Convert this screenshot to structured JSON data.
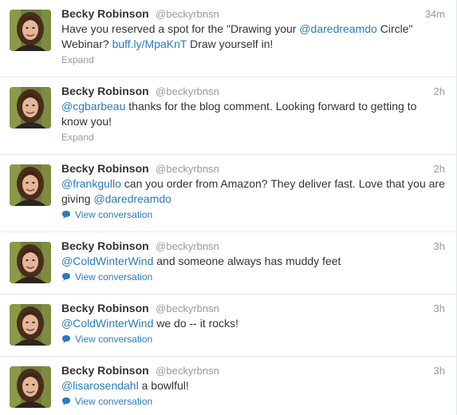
{
  "tweets": [
    {
      "name": "Becky Robinson",
      "handle": "@beckyrbnsn",
      "time": "34m",
      "parts": [
        {
          "t": "Have you reserved a spot for the \"Drawing your ",
          "link": false
        },
        {
          "t": "@daredreamdo",
          "link": true
        },
        {
          "t": " Circle\" Webinar? ",
          "link": false
        },
        {
          "t": "buff.ly/MpaKnT",
          "link": true
        },
        {
          "t": " Draw yourself in!",
          "link": false
        }
      ],
      "footer": "Expand",
      "footer_type": "expand"
    },
    {
      "name": "Becky Robinson",
      "handle": "@beckyrbnsn",
      "time": "2h",
      "parts": [
        {
          "t": "@cgbarbeau",
          "link": true
        },
        {
          "t": " thanks for the blog comment. Looking forward to getting to know you!",
          "link": false
        }
      ],
      "footer": "Expand",
      "footer_type": "expand"
    },
    {
      "name": "Becky Robinson",
      "handle": "@beckyrbnsn",
      "time": "2h",
      "parts": [
        {
          "t": "@frankgullo",
          "link": true
        },
        {
          "t": " can you order from Amazon? They deliver fast. Love that you are giving ",
          "link": false
        },
        {
          "t": "@daredreamdo",
          "link": true
        }
      ],
      "footer": "View conversation",
      "footer_type": "conversation"
    },
    {
      "name": "Becky Robinson",
      "handle": "@beckyrbnsn",
      "time": "3h",
      "parts": [
        {
          "t": "@ColdWinterWind",
          "link": true
        },
        {
          "t": " and someone always has muddy feet",
          "link": false
        }
      ],
      "footer": "View conversation",
      "footer_type": "conversation"
    },
    {
      "name": "Becky Robinson",
      "handle": "@beckyrbnsn",
      "time": "3h",
      "parts": [
        {
          "t": "@ColdWinterWind",
          "link": true
        },
        {
          "t": " we do -- it rocks!",
          "link": false
        }
      ],
      "footer": "View conversation",
      "footer_type": "conversation"
    },
    {
      "name": "Becky Robinson",
      "handle": "@beckyrbnsn",
      "time": "3h",
      "parts": [
        {
          "t": "@lisarosendahl",
          "link": true
        },
        {
          "t": " a bowlful!",
          "link": false
        }
      ],
      "footer": "View conversation",
      "footer_type": "conversation"
    }
  ],
  "colors": {
    "link": "#2b7bb9",
    "muted": "#999999",
    "text": "#333333"
  },
  "icons": {
    "conversation": "speech-bubble-icon"
  }
}
